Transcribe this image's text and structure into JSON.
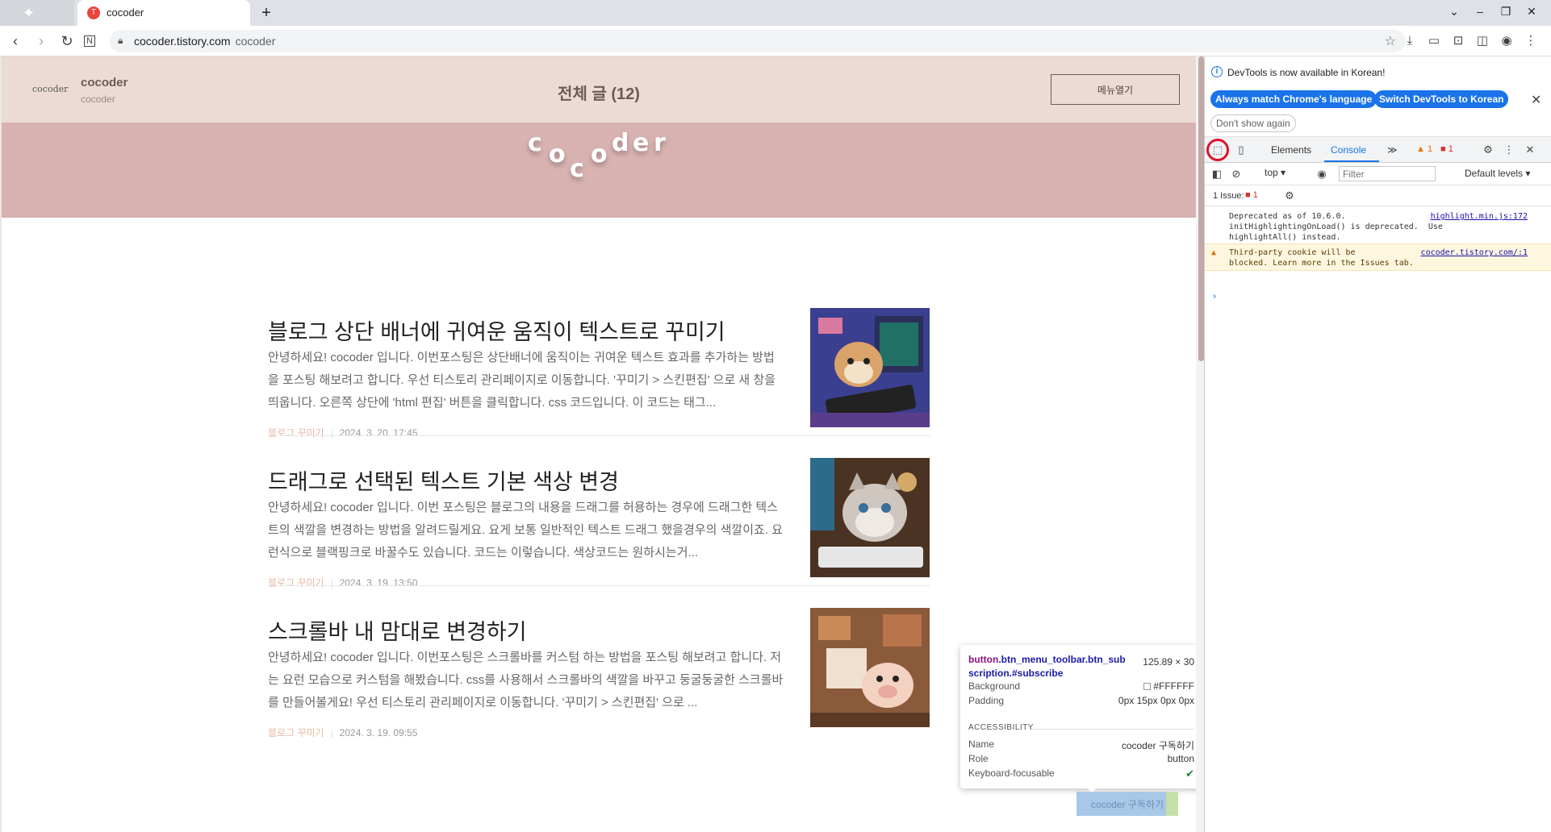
{
  "browser": {
    "tab_title": "cocoder",
    "new_tab": "+",
    "url_host": "cocoder.tistory.com",
    "url_title": "cocoder"
  },
  "blog": {
    "logo_text": "cocoder",
    "name": "cocoder",
    "subtitle": "cocoder",
    "all_posts": "전체 글 (12)",
    "menu_button": "메뉴열기",
    "banner_letters": [
      "c",
      "o",
      "c",
      "o",
      "d",
      "e",
      "r"
    ]
  },
  "posts": [
    {
      "title": "블로그 상단 배너에 귀여운 움직이 텍스트로 꾸미기",
      "summary": "안녕하세요! cocoder 입니다. 이번포스팅은 상단배너에 움직이는 귀여운 텍스트 효과를 추가하는 방법을 포스팅 해보려고 합니다. 우선 티스토리 관리페이지로 이동합니다. '꾸미기 > 스킨편집' 으로 새 창을 띄웁니다. 오른쪽 상단에 'html 편집' 버튼을 클릭합니다. css 코드입니다. 이 코드는 태그...",
      "category": "블로그 꾸미기",
      "date": "2024. 3. 20. 17:45"
    },
    {
      "title": "드래그로 선택된 텍스트 기본 색상 변경",
      "summary": "안녕하세요! cocoder 입니다. 이번 포스팅은 블로그의 내용을 드래그를 허용하는 경우에 드래그한 텍스트의 색깔을 변경하는 방법을 알려드릴게요. 요게 보통 일반적인 텍스트 드래그 했을경우의 색깔이죠. 요런식으로 블랙핑크로 바꿀수도 있습니다. 코드는 이렇습니다. 색상코드는 원하시는거...",
      "category": "블로그 꾸미기",
      "date": "2024. 3. 19. 13:50"
    },
    {
      "title": "스크롤바 내 맘대로 변경하기",
      "summary": "안녕하세요! cocoder 입니다. 이번포스팅은 스크롤바를 커스텀 하는 방법을 포스팅 해보려고 합니다. 저는 요런 모습으로 커스텀을 해봤습니다. css를 사용해서 스크롤바의 색깔을 바꾸고 둥굴둥굴한 스크롤바를 만들어볼게요! 우선 티스토리 관리페이지로 이동합니다. '꾸미기 > 스킨편집' 으로 ...",
      "category": "블로그 꾸미기",
      "date": "2024. 3. 19. 09:55"
    }
  ],
  "inspect_tooltip": {
    "tag": "button",
    "classes": ".btn_menu_toolbar.btn_sub scription.#subscribe",
    "dimensions": "125.89 × 30",
    "background_label": "Background",
    "background_value": "#FFFFFF",
    "padding_label": "Padding",
    "padding_value": "0px 15px 0px 0px",
    "accessibility_label": "ACCESSIBILITY",
    "name_label": "Name",
    "name_value": "cocoder 구독하기",
    "role_label": "Role",
    "role_value": "button",
    "focusable_label": "Keyboard-focusable"
  },
  "subscribe_button": "cocoder 구독하기",
  "devtools": {
    "notice": "DevTools is now available in Korean!",
    "btn_match": "Always match Chrome's language",
    "btn_switch": "Switch DevTools to Korean",
    "btn_dont_show": "Don't show again",
    "tab_elements": "Elements",
    "tab_console": "Console",
    "more_tabs": "≫",
    "warn_count": "1",
    "err_count": "1",
    "context": "top",
    "filter_placeholder": "Filter",
    "levels": "Default levels",
    "issues_label": "1 Issue:",
    "issues_count": "1",
    "messages": [
      {
        "text": "Deprecated as of 10.6.0.\ninitHighlightingOnLoad() is deprecated.  Use\nhighlightAll() instead.",
        "source": "highlight.min.js:172",
        "level": "info"
      },
      {
        "text": "Third-party cookie will be\nblocked. Learn more in the Issues tab.",
        "source": "cocoder.tistory.com/:1",
        "level": "warning"
      }
    ],
    "prompt": "›"
  }
}
